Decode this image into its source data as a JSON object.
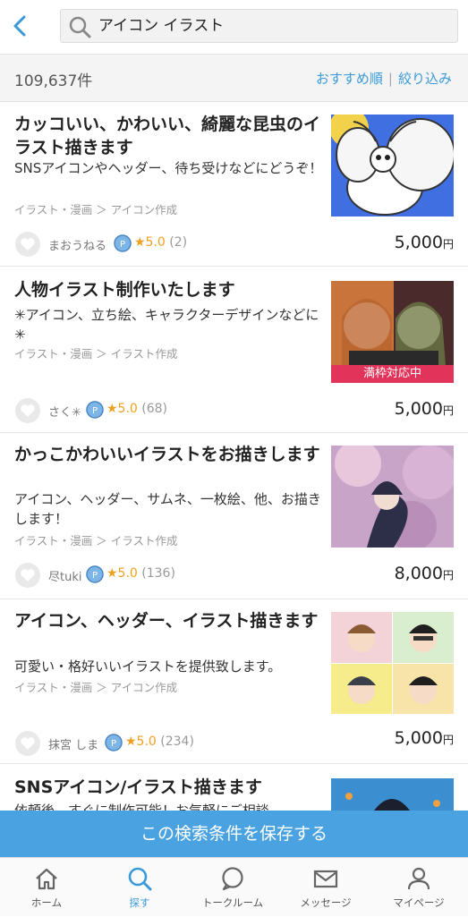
{
  "search": {
    "query": "アイコン イラスト"
  },
  "results": {
    "count": "109,637件",
    "sort_label": "おすすめ順",
    "separator": "|",
    "filter_label": "絞り込み"
  },
  "listings": [
    {
      "title": "カッコいい、かわいい、綺麗な昆虫のイラスト描きます",
      "description": "SNSアイコンやヘッダー、待ち受けなどにどうぞ！",
      "category": "イラスト・漫画 ＞ アイコン作成",
      "seller": "まおうねる",
      "rating": "★5.0",
      "reviews": "(2)",
      "price": "5,000",
      "currency": "円"
    },
    {
      "title": "人物イラスト制作いたします",
      "description": "✳︎アイコン、立ち絵、キャラクターデザインなどに✳︎",
      "category": "イラスト・漫画 ＞ イラスト作成",
      "seller": "さく✳︎",
      "rating": "★5.0",
      "reviews": "(68)",
      "price": "5,000",
      "currency": "円",
      "banner": "満枠対応中"
    },
    {
      "title": "かっこかわいいイラストをお描きします",
      "description": "アイコン、ヘッダー、サムネ、一枚絵、他、お描きします！",
      "category": "イラスト・漫画 ＞ イラスト作成",
      "seller": "尽tuki",
      "rating": "★5.0",
      "reviews": "(136)",
      "price": "8,000",
      "currency": "円"
    },
    {
      "title": "アイコン、ヘッダー、イラスト描きます",
      "description": "可愛い・格好いいイラストを提供致します。",
      "category": "イラスト・漫画 ＞ アイコン作成",
      "seller": "抹宮 しま",
      "rating": "★5.0",
      "reviews": "(234)",
      "price": "5,000",
      "currency": "円"
    },
    {
      "title": "SNSアイコン/イラスト描きます",
      "description": "依頼後、すぐに制作可能！お気軽にご相談"
    }
  ],
  "save_button": "この検索条件を保存する",
  "tabs": [
    {
      "label": "ホーム",
      "icon": "home-icon"
    },
    {
      "label": "探す",
      "icon": "search-icon",
      "active": true
    },
    {
      "label": "トークルーム",
      "icon": "chat-bubble-icon"
    },
    {
      "label": "メッセージ",
      "icon": "mail-icon"
    },
    {
      "label": "マイページ",
      "icon": "person-icon"
    }
  ],
  "colors": {
    "accent": "#3a9ad9",
    "save_bar": "#4aa3e0",
    "star": "#f0a020",
    "banner": "#e2345a"
  }
}
